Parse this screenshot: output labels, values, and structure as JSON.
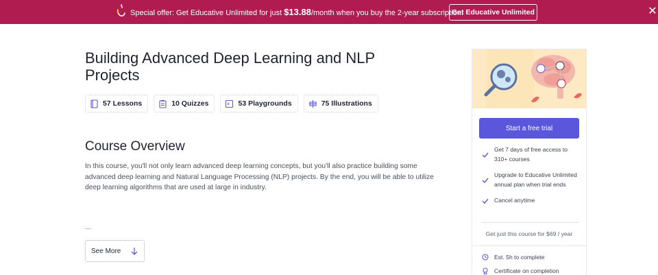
{
  "banner": {
    "offer_prefix": "Special offer: Get Educative Unlimited for just ",
    "price": "$13.88",
    "offer_suffix": "/month when you buy the 2-year subscription.",
    "cta_label": "Get Educative Unlimited",
    "close_icon": "close-icon",
    "background": "#b01b50"
  },
  "course": {
    "title": "Building Advanced Deep Learning and NLP Projects",
    "stats": [
      {
        "icon": "lessons-icon",
        "label": "57 Lessons"
      },
      {
        "icon": "quizzes-icon",
        "label": "10 Quizzes"
      },
      {
        "icon": "playgrounds-icon",
        "label": "53 Playgrounds"
      },
      {
        "icon": "illustrations-icon",
        "label": "75 Illustrations"
      }
    ]
  },
  "overview": {
    "heading": "Course Overview",
    "text": "In this course, you'll not only learn advanced deep learning concepts, but you'll also practice building some advanced deep learning and Natural Language Processing (NLP) projects. By the end, you will be able to utilize deep learning algorithms that are used at large in industry.",
    "ellipsis": "...",
    "see_more_label": "See More"
  },
  "sidebar": {
    "trial_button": "Start a free trial",
    "accent": "#5a57dd",
    "benefits": [
      "Get 7 days of free access to 310+ courses",
      "Upgrade to Educative Unlimited annual plan when trial ends",
      "Cancel anytime"
    ],
    "price_line": "Get just this course for $69 / year",
    "meta": [
      {
        "icon": "clock-icon",
        "label": "Est. 5h to complete"
      },
      {
        "icon": "certificate-icon",
        "label": "Certificate on completion"
      }
    ]
  }
}
